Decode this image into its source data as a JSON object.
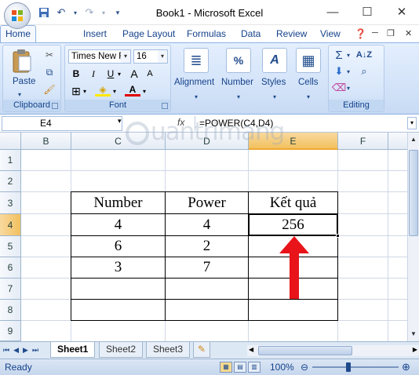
{
  "window": {
    "title": "Book1 - Microsoft Excel",
    "minimize": "—",
    "maximize": "☐",
    "close": "✕"
  },
  "ribbon_tabs": [
    "Home",
    "Insert",
    "Page Layout",
    "Formulas",
    "Data",
    "Review",
    "View"
  ],
  "ribbon": {
    "clipboard": {
      "label": "Clipboard",
      "paste": "Paste"
    },
    "font": {
      "label": "Font",
      "name": "Times New Ro",
      "size": "16",
      "bold": "B",
      "italic": "I",
      "underline": "U",
      "grow": "A",
      "shrink": "A"
    },
    "alignment": "Alignment",
    "number": "Number",
    "styles": "Styles",
    "cells": "Cells",
    "editing": "Editing"
  },
  "formula_bar": {
    "name_box": "E4",
    "fx": "fx",
    "formula": "=POWER(C4,D4)"
  },
  "columns": [
    "B",
    "C",
    "D",
    "E",
    "F"
  ],
  "rows": [
    "1",
    "2",
    "3",
    "4",
    "5",
    "6",
    "7",
    "8",
    "9"
  ],
  "table": {
    "headers": [
      "Number",
      "Power",
      "Kết quả"
    ],
    "rows": [
      [
        "4",
        "4",
        "256"
      ],
      [
        "6",
        "2",
        ""
      ],
      [
        "3",
        "7",
        ""
      ],
      [
        "",
        "",
        ""
      ],
      [
        "",
        "",
        ""
      ]
    ]
  },
  "active_cell": "E4",
  "sheets": [
    "Sheet1",
    "Sheet2",
    "Sheet3"
  ],
  "active_sheet": "Sheet1",
  "status": {
    "text": "Ready",
    "zoom": "100%",
    "zoom_level_percent": 100
  },
  "watermark": "uantrimang",
  "colors": {
    "arrow": "#e8141a",
    "selected_header": "#f1c15f",
    "ribbon_text": "#15428b"
  }
}
